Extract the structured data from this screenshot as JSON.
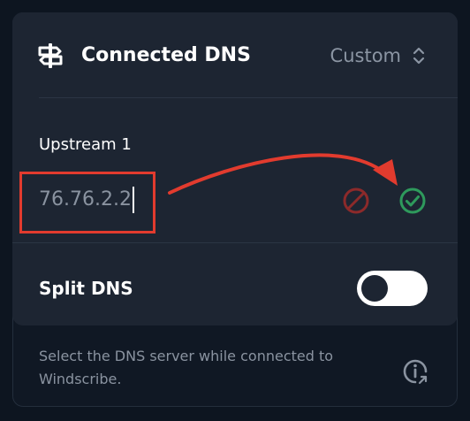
{
  "header": {
    "title": "Connected DNS",
    "mode_value": "Custom",
    "icon": "signpost-icon",
    "chevron_icon": "chevron-up-down-icon"
  },
  "upstream": {
    "label": "Upstream 1",
    "value": "76.76.2.2",
    "cancel_icon": "cancel-icon",
    "confirm_icon": "check-circle-icon"
  },
  "split_dns": {
    "label": "Split DNS",
    "enabled": false
  },
  "footer": {
    "description": "Select the DNS server while connected to Windscribe.",
    "info_icon": "info-icon"
  },
  "colors": {
    "annotation_red": "#e23b2e",
    "cancel_red": "#8c2a2a",
    "confirm_green": "#2e9a5c",
    "card_bg": "#1d2532",
    "page_bg": "#0d1520"
  }
}
